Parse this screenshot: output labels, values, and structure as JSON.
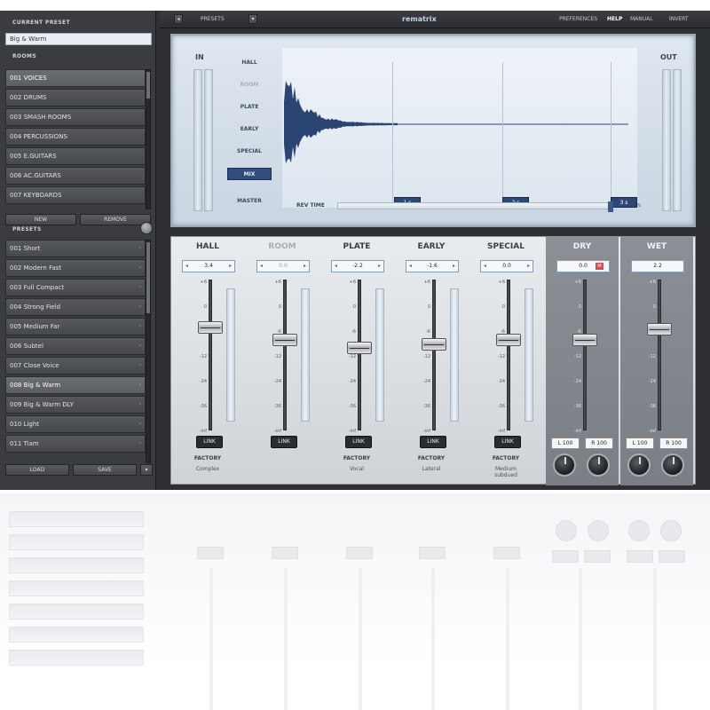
{
  "left": {
    "current_preset_label": "CURRENT PRESET",
    "current_preset": "Big & Warm",
    "rooms_label": "ROOMS",
    "rooms": [
      "001  VOICES",
      "002  DRUMS",
      "003  SMASH ROOMS",
      "004  PERCUSSIONS",
      "005  E.GUITARS",
      "006  AC.GUITARS",
      "007  KEYBOARDS"
    ],
    "rooms_buttons": [
      "NEW",
      "REMOVE"
    ],
    "presets_label": "PRESETS",
    "presets": [
      "001  Short",
      "002  Modern Fast",
      "003  Full Compact",
      "004  Strong Field",
      "005  Medium Far",
      "006  Subtel",
      "007  Close Voice",
      "008  Big & Warm",
      "009  Big & Warm DLY",
      "010  Light",
      "011  Tiam"
    ],
    "selected_preset_index": 7,
    "presets_buttons": [
      "LOAD",
      "SAVE"
    ]
  },
  "topbar": {
    "presets": "PRESETS",
    "logo": "rematrix",
    "links": [
      "PREFERENCES",
      "HELP",
      "MANUAL",
      "INVERT"
    ]
  },
  "display": {
    "in_label": "IN",
    "out_label": "OUT",
    "modes": [
      "HALL",
      "ROOM",
      "PLATE",
      "EARLY",
      "SPECIAL",
      "MIX"
    ],
    "active_mode": "MIX",
    "master_label": "MASTER",
    "rev_time_label": "REV TIME",
    "markers": [
      "1 s",
      "2 s",
      "3 s"
    ],
    "rev_time_value": "100%"
  },
  "channels": [
    {
      "name": "HALL",
      "value": "3.4",
      "fader": 0.68,
      "factory": "FACTORY",
      "type": "Complex"
    },
    {
      "name": "ROOM",
      "value": "0.0",
      "fader": 0.6,
      "factory": "",
      "type": "",
      "dim": true
    },
    {
      "name": "PLATE",
      "value": "-2.2",
      "fader": 0.55,
      "factory": "FACTORY",
      "type": "Vocal"
    },
    {
      "name": "EARLY",
      "value": "-1.6",
      "fader": 0.57,
      "factory": "FACTORY",
      "type": "Lateral"
    },
    {
      "name": "SPECIAL",
      "value": "0.0",
      "fader": 0.6,
      "factory": "FACTORY",
      "type": "Medium\nsubdued"
    }
  ],
  "outputs": [
    {
      "name": "DRY",
      "value": "0.0",
      "fader": 0.6,
      "left": "L 100",
      "right": "R 100",
      "mute": "M"
    },
    {
      "name": "WET",
      "value": "2.2",
      "fader": 0.67,
      "left": "L 100",
      "right": "R 100"
    }
  ],
  "scale": [
    "+6",
    "0",
    "-6",
    "-12",
    "-24",
    "-36",
    "-inf"
  ],
  "link_label": "LINK"
}
